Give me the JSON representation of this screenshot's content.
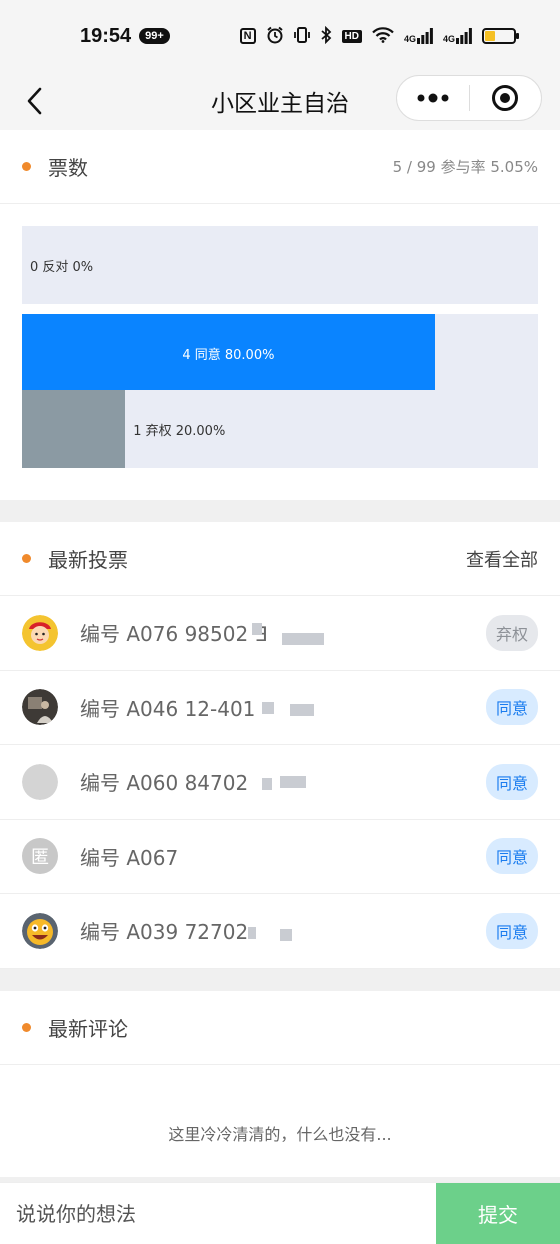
{
  "status_bar": {
    "time": "19:54",
    "notification_count": "99+",
    "nfc": "N",
    "hd": "HD",
    "net1": "4G",
    "net2": "4G",
    "battery_level": 0.35
  },
  "nav": {
    "title": "小区业主自治"
  },
  "votes": {
    "title": "票数",
    "summary": "5 / 99 参与率 5.05%",
    "bars": [
      {
        "label": "0 反对 0%",
        "fraction": 0.0,
        "color": "#e9ecf5"
      },
      {
        "label": "4 同意 80.00%",
        "fraction": 0.8,
        "color": "#0a84ff"
      },
      {
        "label": "1 弃权 20.00%",
        "fraction": 0.2,
        "color": "#8b9aa3"
      }
    ]
  },
  "latest_votes": {
    "title": "最新投票",
    "view_all": "查看全部",
    "items": [
      {
        "text": "编号 A076 98502 ∃",
        "status": "弃权",
        "type": "abstain",
        "avatar": "cartoon-avatar"
      },
      {
        "text": "编号 A046 12-401",
        "status": "同意",
        "type": "agree",
        "avatar": "photo-avatar"
      },
      {
        "text": "编号 A060 84702",
        "status": "同意",
        "type": "agree",
        "avatar": "gray-avatar"
      },
      {
        "text": "编号 A067",
        "status": "同意",
        "type": "agree",
        "avatar": "anonymous-avatar",
        "avatar_char": "匿"
      },
      {
        "text": "编号 A039 72702",
        "status": "同意",
        "type": "agree",
        "avatar": "emoji-avatar"
      }
    ]
  },
  "latest_comments": {
    "title": "最新评论",
    "empty_text": "这里冷冷清清的，什么也没有..."
  },
  "composer": {
    "placeholder": "说说你的想法",
    "submit_label": "提交"
  },
  "colors": {
    "accent_dot": "#f08a2c",
    "agree_blue": "#0a84ff",
    "abstain_gray": "#8b9aa3",
    "submit_green": "#6cd08a"
  }
}
